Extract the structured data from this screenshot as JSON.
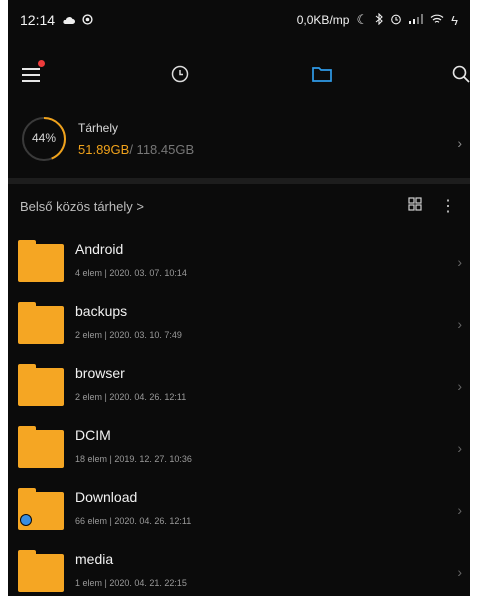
{
  "status_bar": {
    "time": "12:14",
    "network_speed": "0,0KB/mp",
    "icons": [
      "cloud-icon",
      "circle-icon",
      "moon-icon",
      "bluetooth-icon",
      "alarm-icon",
      "signal-icon",
      "wifi-icon",
      "battery-charging-icon"
    ]
  },
  "toolbar": {
    "icons": [
      "menu-icon",
      "recent-clock-icon",
      "folder-tab-icon",
      "search-icon"
    ]
  },
  "storage": {
    "percent_label": "44%",
    "percent_value": 44,
    "label": "Tárhely",
    "used": "51.89GB",
    "total": "/ 118.45GB",
    "accent": "#f0a21b"
  },
  "section": {
    "title": "Belső közös tárhely >"
  },
  "files": [
    {
      "name": "Android",
      "meta": "4 elem | 2020. 03. 07. 10:14"
    },
    {
      "name": "backups",
      "meta": "2 elem | 2020. 03. 10. 7:49"
    },
    {
      "name": "browser",
      "meta": "2 elem | 2020. 04. 26. 12:11"
    },
    {
      "name": "DCIM",
      "meta": "18 elem | 2019. 12. 27. 10:36"
    },
    {
      "name": "Download",
      "meta": "66 elem | 2020. 04. 26. 12:11"
    },
    {
      "name": "media",
      "meta": "1 elem | 2020. 04. 21. 22:15"
    }
  ]
}
